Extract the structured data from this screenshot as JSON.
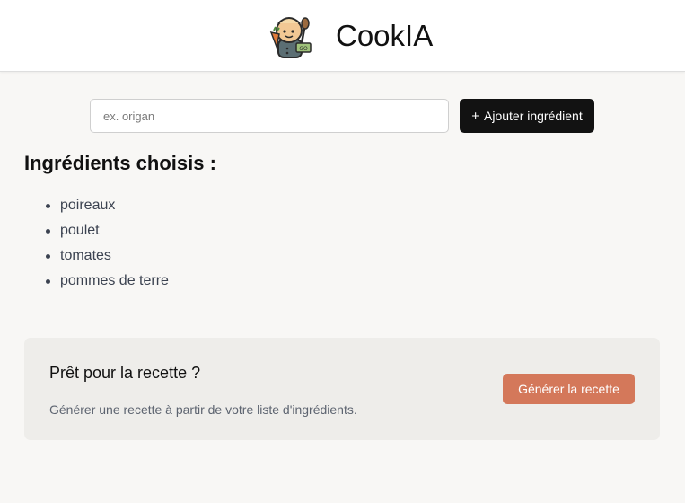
{
  "header": {
    "logo_icon": "chef-mascot-logo-icon",
    "title": "CookIA"
  },
  "search": {
    "placeholder": "ex. origan",
    "value": ""
  },
  "add_button": {
    "icon": "plus-icon",
    "icon_glyph": "+",
    "label": "Ajouter ingrédient"
  },
  "ingredients": {
    "title": "Ingrédients choisis :",
    "items": [
      "poireaux",
      "poulet",
      "tomates",
      "pommes de terre"
    ]
  },
  "cta": {
    "title": "Prêt pour la recette ?",
    "description": "Générer une recette à partir de votre liste d'ingrédients.",
    "button_label": "Générer la recette"
  },
  "colors": {
    "background": "#f8f7f5",
    "primary_button": "#121212",
    "accent": "#d4785a",
    "card": "#eeedea"
  }
}
